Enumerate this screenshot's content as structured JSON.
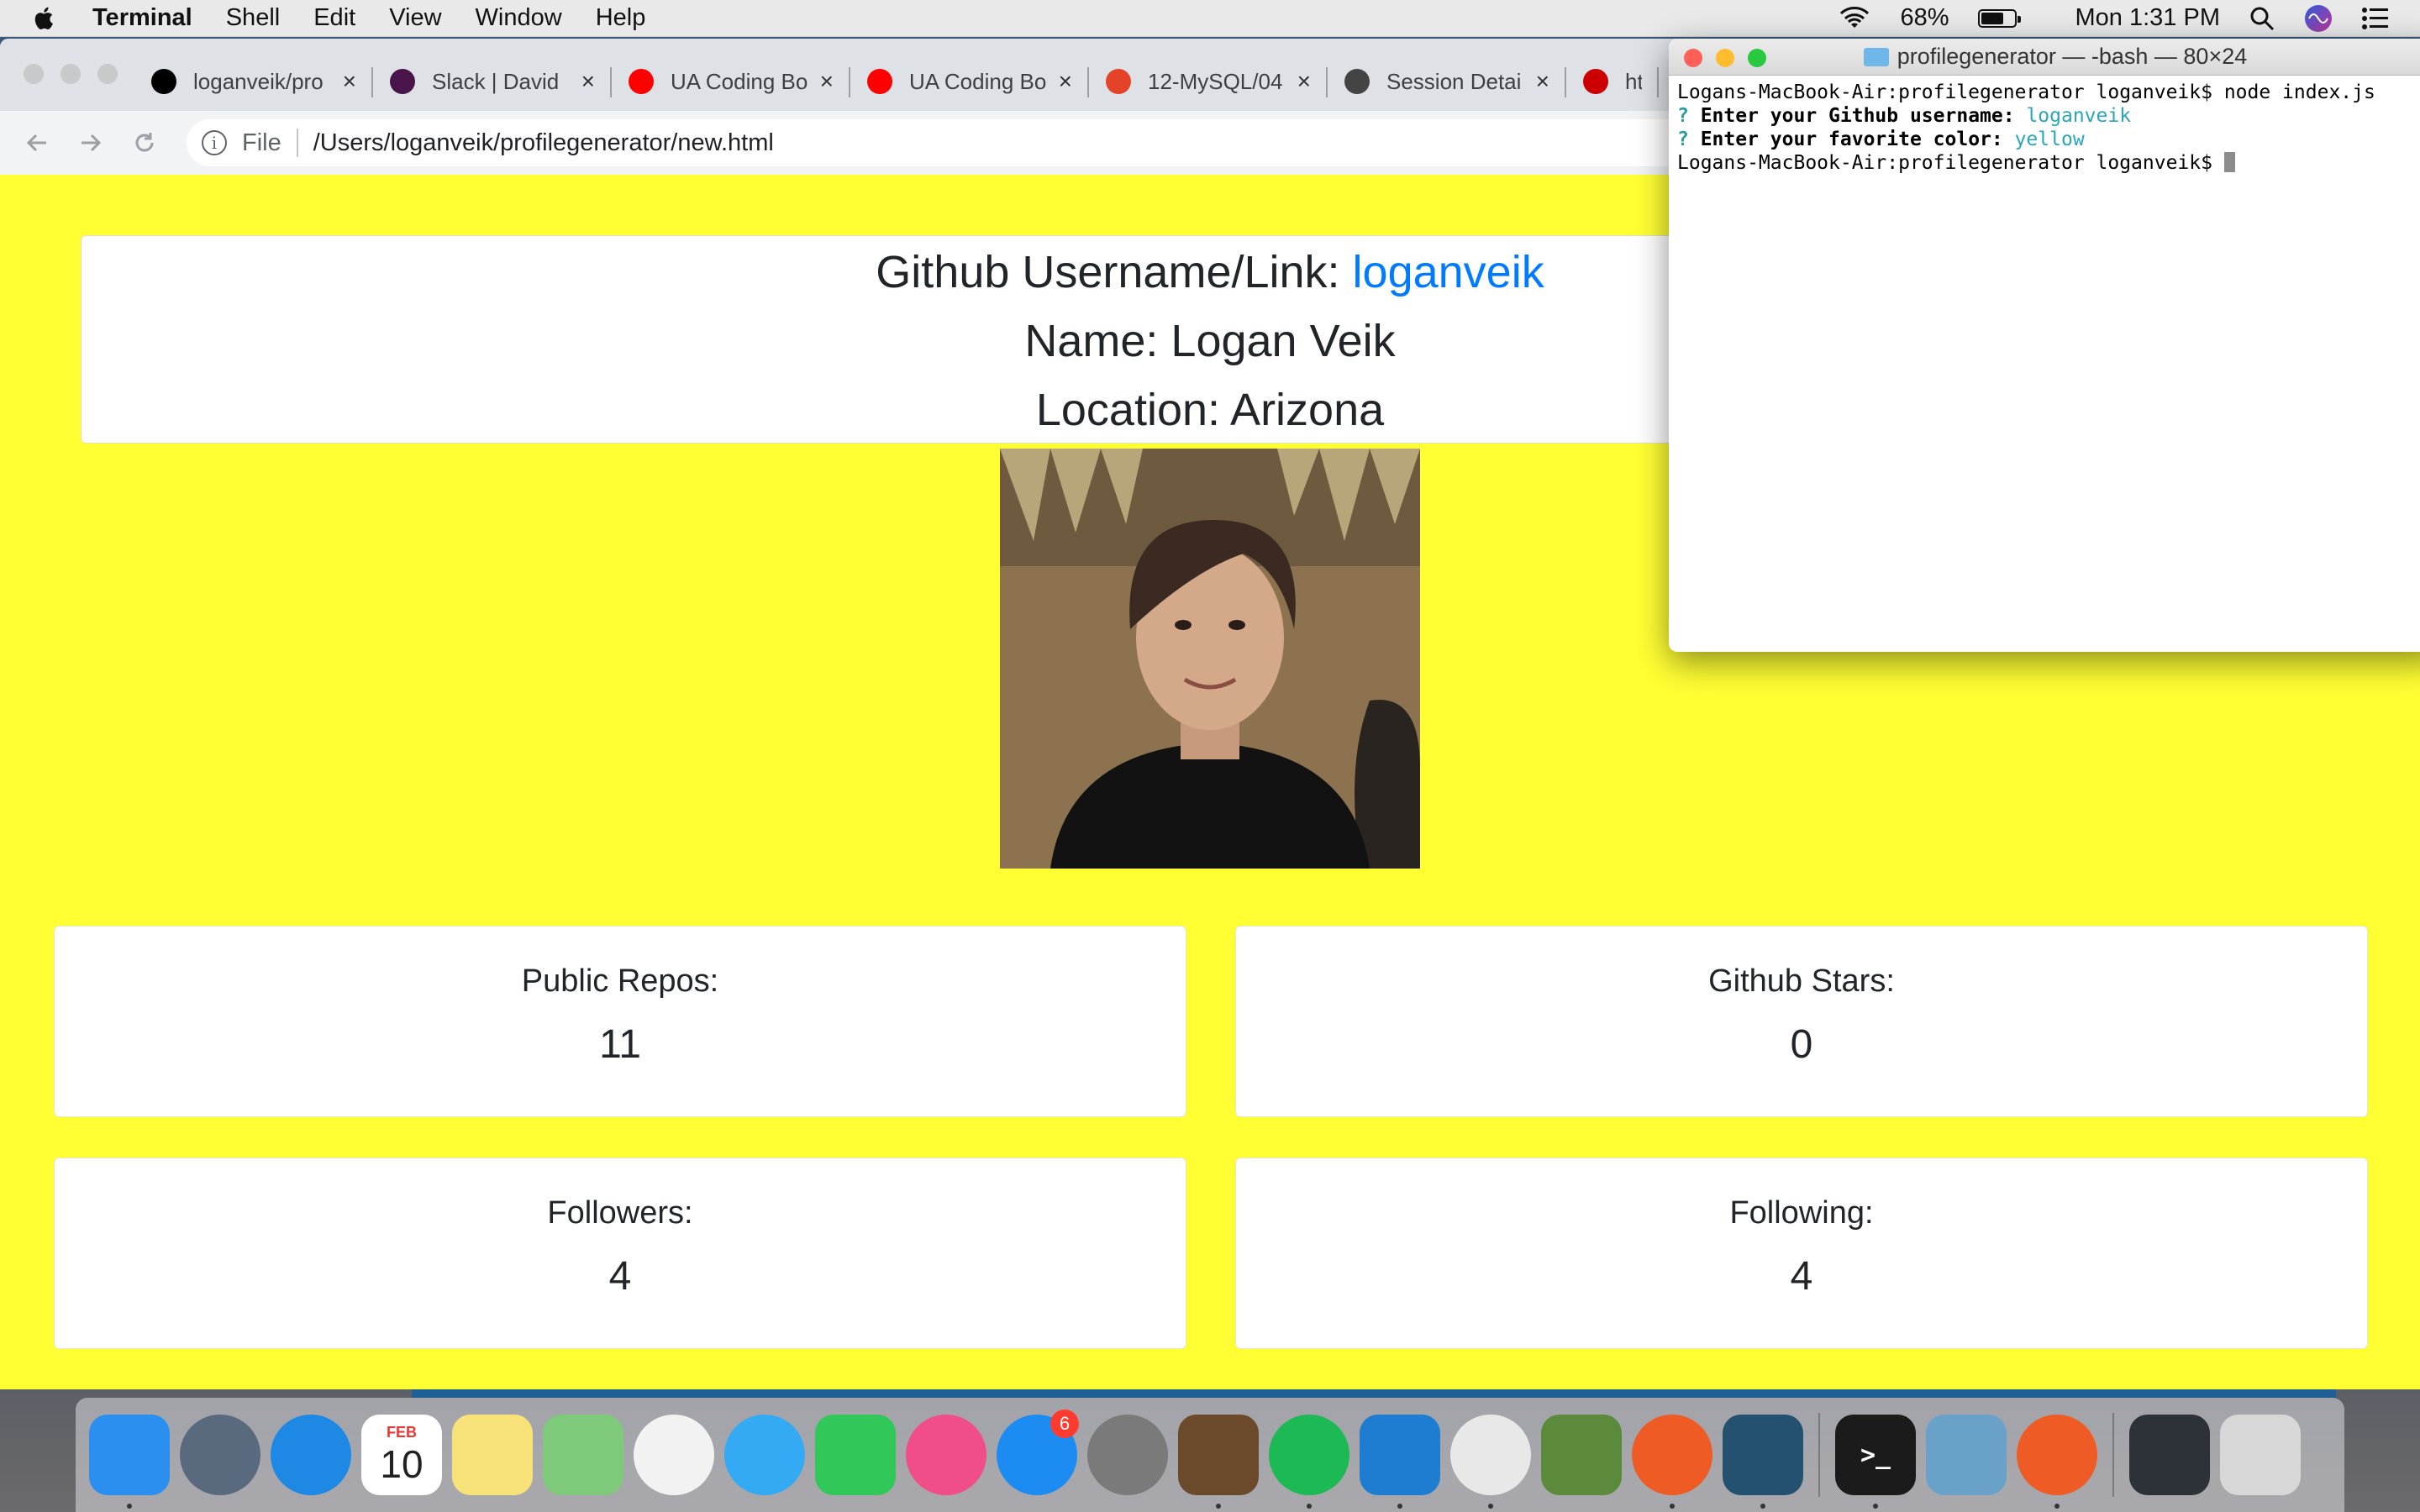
{
  "menubar": {
    "items": [
      "Terminal",
      "Shell",
      "Edit",
      "View",
      "Window",
      "Help"
    ],
    "battery": "68%",
    "battery_level": 0.68,
    "clock": "Mon 1:31 PM"
  },
  "browser": {
    "tabs": [
      {
        "title": "loganveik/pro",
        "icon": "github-icon",
        "color": "#000000"
      },
      {
        "title": "Slack | David",
        "icon": "slack-icon",
        "color": "#4a154b"
      },
      {
        "title": "UA Coding Bo",
        "icon": "youtube-icon",
        "color": "#ff0000"
      },
      {
        "title": "UA Coding Bo",
        "icon": "youtube-icon",
        "color": "#ff0000"
      },
      {
        "title": "12-MySQL/04",
        "icon": "gitlab-icon",
        "color": "#e24329"
      },
      {
        "title": "Session Detai",
        "icon": "globe-icon",
        "color": "#444444"
      },
      {
        "title": "html-",
        "icon": "html-icon",
        "color": "#cc0000"
      }
    ],
    "omnibox": {
      "scheme": "File",
      "path": "/Users/loganveik/profilegenerator/new.html"
    }
  },
  "profile": {
    "username_label": "Github Username/Link: ",
    "username": "loganveik",
    "name": "Name: Logan Veik",
    "location": "Location: Arizona",
    "stats": {
      "repos_label": "Public Repos:",
      "repos_value": "11",
      "stars_label": "Github Stars:",
      "stars_value": "0",
      "followers_label": "Followers:",
      "followers_value": "4",
      "following_label": "Following:",
      "following_value": "4"
    },
    "background_color": "#ffff33"
  },
  "terminal": {
    "title": "profilegenerator — -bash — 80×24",
    "line1": "Logans-MacBook-Air:profilegenerator loganveik$ node index.js",
    "q1": "? ",
    "q1_text": "Enter your Github username: ",
    "q1_answer": "loganveik",
    "q2": "? ",
    "q2_text": "Enter your favorite color: ",
    "q2_answer": "yellow",
    "prompt": "Logans-MacBook-Air:profilegenerator loganveik$ "
  },
  "dock": {
    "apps": [
      {
        "name": "finder-icon",
        "color": "#2b8ff0"
      },
      {
        "name": "launchpad-icon",
        "color": "#5a6a7e"
      },
      {
        "name": "safari-icon",
        "color": "#1e88e5"
      },
      {
        "name": "calendar-icon",
        "color": "#ffffff"
      },
      {
        "name": "notes-icon",
        "color": "#f7e27a"
      },
      {
        "name": "maps-icon",
        "color": "#7fc97a"
      },
      {
        "name": "photos-icon",
        "color": "#f2f2f2"
      },
      {
        "name": "messages-icon",
        "color": "#34aaf5"
      },
      {
        "name": "facetime-icon",
        "color": "#32c759"
      },
      {
        "name": "itunes-icon",
        "color": "#f04e8a"
      },
      {
        "name": "app-store-icon",
        "color": "#1d8cf2"
      },
      {
        "name": "system-preferences-icon",
        "color": "#7a7a7a"
      },
      {
        "name": "garageband-icon",
        "color": "#6b4a2b"
      },
      {
        "name": "spotify-icon",
        "color": "#1db954"
      },
      {
        "name": "vscode-icon",
        "color": "#1e7dd1"
      },
      {
        "name": "chrome-icon",
        "color": "#e8e8e8"
      },
      {
        "name": "minecraft-icon",
        "color": "#5b8a3c"
      },
      {
        "name": "postman-icon",
        "color": "#ef5b25"
      },
      {
        "name": "mysql-workbench-icon",
        "color": "#23516f"
      },
      {
        "name": "terminal-icon",
        "color": "#1b1b1b"
      },
      {
        "name": "preview-icon",
        "color": "#6aa1c9"
      },
      {
        "name": "postman-icon",
        "color": "#ef5b25"
      },
      {
        "name": "downloads-icon",
        "color": "#2d3238"
      },
      {
        "name": "trash-icon",
        "color": "#d7d7d7"
      }
    ],
    "calendar_month": "FEB",
    "calendar_day": "10",
    "app_store_badge": "6"
  }
}
